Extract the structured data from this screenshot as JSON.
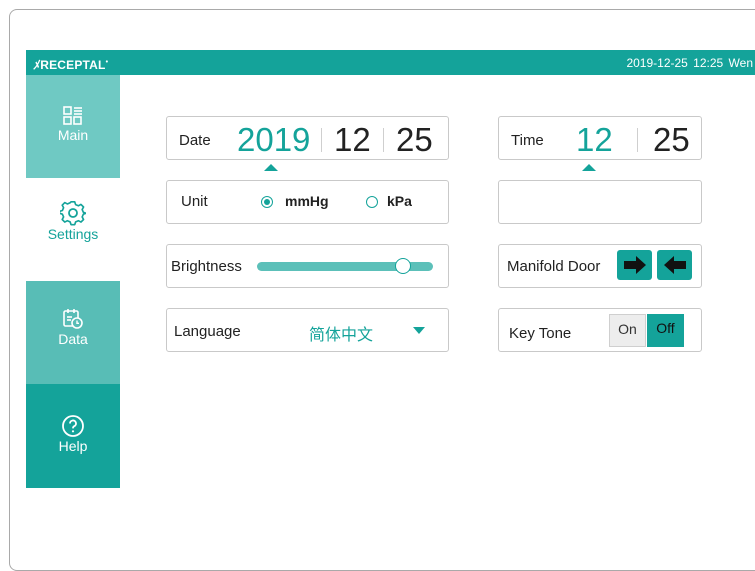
{
  "header": {
    "brand": "RECEPTAL",
    "brand_mark": "ﾒ",
    "datetime": "2019-12-25  12:25  Wen"
  },
  "sidebar": {
    "items": [
      {
        "label": "Main",
        "icon": "dashboard-grid-icon",
        "active": false
      },
      {
        "label": "Settings",
        "icon": "gear-icon",
        "active": true
      },
      {
        "label": "Data",
        "icon": "calendar-clock-icon",
        "active": false
      },
      {
        "label": "Help",
        "icon": "question-circle-icon",
        "active": false
      }
    ]
  },
  "settings": {
    "date": {
      "label": "Date",
      "year": "2019",
      "month": "12",
      "day": "25",
      "selected": "year"
    },
    "time": {
      "label": "Time",
      "hour": "12",
      "minute": "25",
      "selected": "hour"
    },
    "unit": {
      "label": "Unit",
      "options": [
        "mmHg",
        "kPa"
      ],
      "selected": "mmHg"
    },
    "brightness": {
      "label": "Brightness",
      "value_fraction": 0.83
    },
    "manifold_door": {
      "label": "Manifold Door",
      "buttons": [
        "arrow-right-icon",
        "arrow-left-icon"
      ]
    },
    "language": {
      "label": "Language",
      "value": "简体中文"
    },
    "key_tone": {
      "label": "Key Tone",
      "on_label": "On",
      "off_label": "Off",
      "selected": "Off"
    }
  },
  "colors": {
    "accent": "#14a39a",
    "sidebar_main": "#6fc9c3",
    "sidebar_data": "#58bdb6",
    "slider_track": "#5cc0b9"
  }
}
